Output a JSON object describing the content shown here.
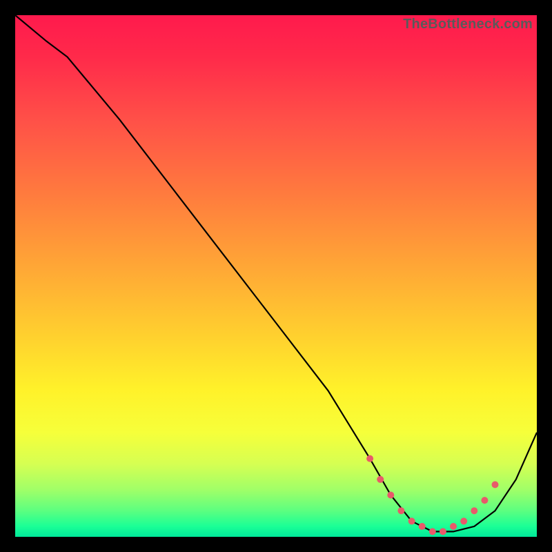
{
  "watermark": "TheBottleneck.com",
  "chart_data": {
    "type": "line",
    "title": "",
    "xlabel": "",
    "ylabel": "",
    "xlim": [
      0,
      100
    ],
    "ylim": [
      0,
      100
    ],
    "x": [
      0,
      6,
      10,
      20,
      30,
      40,
      50,
      60,
      68,
      72,
      76,
      80,
      84,
      88,
      92,
      96,
      100
    ],
    "values": [
      100,
      95,
      92,
      80,
      67,
      54,
      41,
      28,
      15,
      8,
      3,
      1,
      1,
      2,
      5,
      11,
      20
    ],
    "markers": {
      "x": [
        68,
        70,
        72,
        74,
        76,
        78,
        80,
        82,
        84,
        86,
        88,
        90,
        92
      ],
      "values": [
        15,
        11,
        8,
        5,
        3,
        2,
        1,
        1,
        2,
        3,
        5,
        7,
        10
      ]
    },
    "gradient_stops": [
      {
        "pos": 0.0,
        "color": "#ff1a4d"
      },
      {
        "pos": 0.5,
        "color": "#ffb030"
      },
      {
        "pos": 0.8,
        "color": "#f6ff3a"
      },
      {
        "pos": 1.0,
        "color": "#00e89a"
      }
    ]
  }
}
